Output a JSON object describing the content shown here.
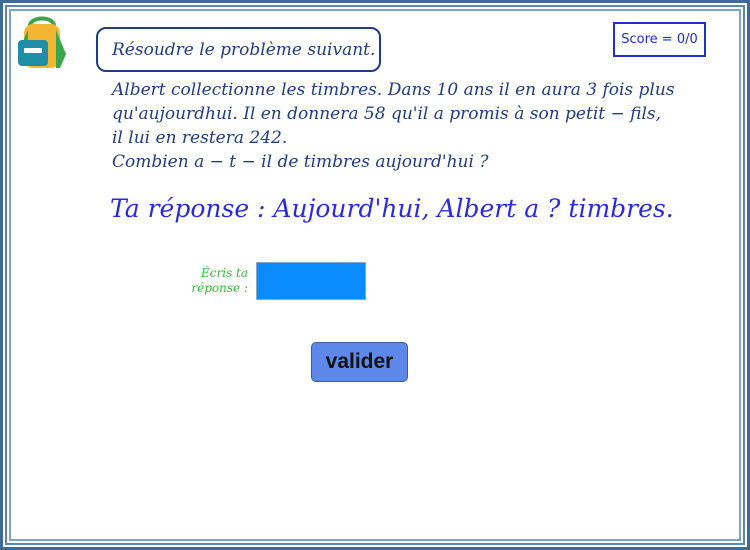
{
  "header": {
    "title": "Résoudre le problème suivant.",
    "score": "Score = 0/0",
    "logo_icon": "backpack-icon"
  },
  "problem": {
    "lines": [
      "Albert collectionne les timbres. Dans 10 ans il en aura 3 fois plus",
      "qu'aujourdhui. Il en donnera 58 qu'il a promis à son petit − fils,",
      "il lui en restera 242.",
      "Combien a − t − il de timbres aujourd'hui ?"
    ]
  },
  "answer_prompt": "Ta réponse : Aujourd'hui,  Albert a ? timbres.",
  "input": {
    "label_line1": "Écris ta",
    "label_line2": "réponse :",
    "value": ""
  },
  "actions": {
    "submit_label": "valider"
  },
  "colors": {
    "border_dark": "#3d6b96",
    "title": "#1f3c88",
    "score": "#1f2fd0",
    "answer": "#2a2adf",
    "label": "#2fbf2f",
    "input_bg": "#0a8cff",
    "button_bg": "#5d87e8"
  }
}
